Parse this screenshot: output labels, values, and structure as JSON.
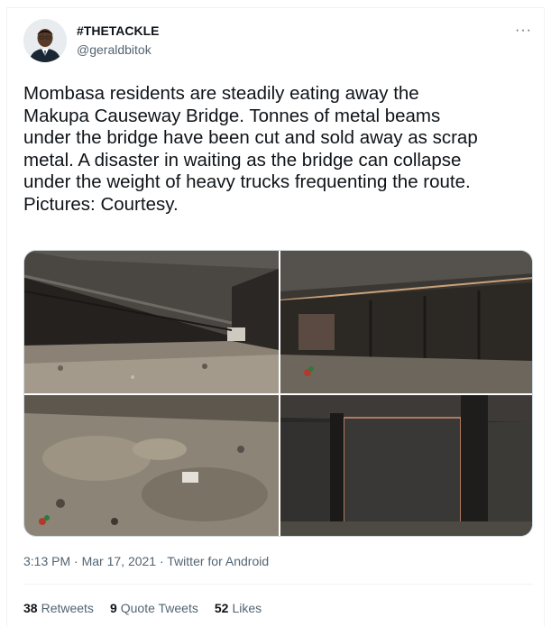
{
  "author": {
    "display_name": "#THETACKLE",
    "handle": "@geraldbitok",
    "avatar_icon": "person-avatar"
  },
  "more_icon": "···",
  "tweet": {
    "text": "Mombasa residents are steadily eating away the\nMakupa Causeway Bridge. Tonnes of metal beams\nunder the bridge have been cut and sold away as scrap\nmetal. A disaster in waiting as the bridge can collapse\nunder the weight of heavy trucks frequenting the route.\nPictures: Courtesy."
  },
  "media": {
    "photos": [
      "photo-1",
      "photo-2",
      "photo-3",
      "photo-4"
    ]
  },
  "meta": {
    "time": "3:13 PM",
    "separator": "·",
    "date": "Mar 17, 2021",
    "source": "Twitter for Android"
  },
  "stats": {
    "retweets_count": "38",
    "retweets_label": "Retweets",
    "quotes_count": "9",
    "quotes_label": "Quote Tweets",
    "likes_count": "52",
    "likes_label": "Likes"
  },
  "colors": {
    "text_primary": "#0f1419",
    "text_secondary": "#536471",
    "border": "#cfd9de"
  }
}
